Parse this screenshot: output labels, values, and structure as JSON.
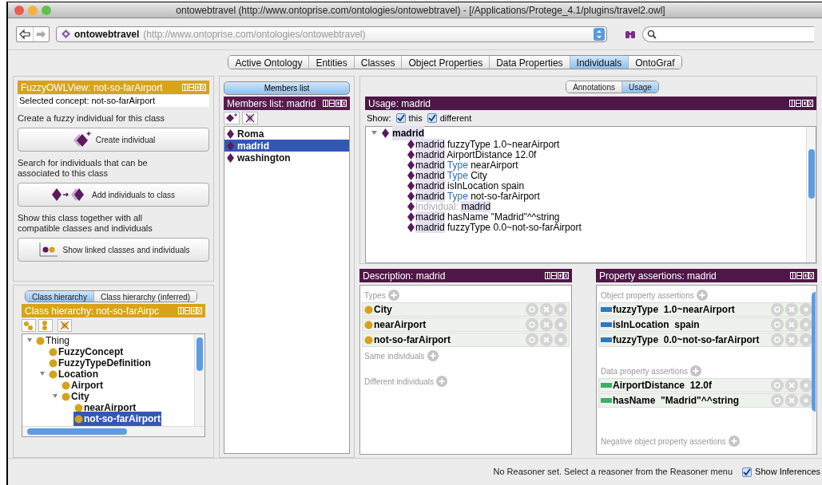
{
  "window": {
    "title": "ontowebtravel (http://www.ontoprise.com/ontologies/ontowebtravel) - [/Applications/Protege_4.1/plugins/travel2.owl]"
  },
  "address_bar": {
    "name": "ontowebtravel",
    "iri": "(http://www.ontoprise.com/ontologies/ontowebtravel)"
  },
  "tabs": [
    {
      "label": "Active Ontology",
      "selected": false
    },
    {
      "label": "Entities",
      "selected": false
    },
    {
      "label": "Classes",
      "selected": false
    },
    {
      "label": "Object Properties",
      "selected": false
    },
    {
      "label": "Data Properties",
      "selected": false
    },
    {
      "label": "Individuals",
      "selected": true
    },
    {
      "label": "OntoGraf",
      "selected": false
    }
  ],
  "fuzzy_owl_view": {
    "title": "FuzzyOWLView: not-so-farAirport",
    "selected_concept": "Selected concept: not-so-farAirport",
    "sections": [
      {
        "kind": "create",
        "text": "Create a fuzzy individual for this class",
        "button": "Create individual"
      },
      {
        "kind": "add",
        "text": "Search for individuals that can be associated to this class",
        "button": "Add individuals to class"
      },
      {
        "kind": "linked",
        "text": "Show this class together with all compatible classes and individuals",
        "button": "Show linked classes and individuals"
      }
    ]
  },
  "class_hierarchy": {
    "tabs": [
      {
        "label": "Class hierarchy",
        "selected": true
      },
      {
        "label": "Class hierarchy (inferred)",
        "selected": false
      }
    ],
    "title": "Class hierarchy: not-so-farAirpc",
    "tree": [
      {
        "label": "Thing",
        "expanded": true,
        "selected": false,
        "children": [
          {
            "label": "FuzzyConcept",
            "selected": false
          },
          {
            "label": "FuzzyTypeDefinition",
            "selected": false
          },
          {
            "label": "Location",
            "expanded": true,
            "selected": false,
            "children": [
              {
                "label": "Airport",
                "selected": false
              },
              {
                "label": "City",
                "expanded": true,
                "selected": false,
                "children": [
                  {
                    "label": "nearAirport",
                    "selected": false
                  },
                  {
                    "label": "not-so-farAirport",
                    "selected": true
                  }
                ]
              }
            ]
          }
        ]
      }
    ]
  },
  "members": {
    "button": "Members list",
    "title": "Members list: madrid",
    "items": [
      {
        "label": "Roma",
        "selected": false
      },
      {
        "label": "madrid",
        "selected": true
      },
      {
        "label": "washington",
        "selected": false
      }
    ]
  },
  "usage": {
    "tabs": [
      {
        "label": "Annotations",
        "selected": false
      },
      {
        "label": "Usage",
        "selected": true
      }
    ],
    "title": "Usage: madrid",
    "show_label": "Show:",
    "checkboxes": [
      {
        "label": "this",
        "checked": true
      },
      {
        "label": "different",
        "checked": true
      }
    ],
    "root": {
      "label": "madrid",
      "expanded": true
    },
    "lines": [
      {
        "kind": "plain",
        "subject": "madrid",
        "text": "fuzzyType 1.0~nearAirport"
      },
      {
        "kind": "plain",
        "subject": "madrid",
        "text": "AirportDistance 12.0f"
      },
      {
        "kind": "keyword",
        "subject": "madrid",
        "keyword": "Type",
        "text": "nearAirport"
      },
      {
        "kind": "keyword",
        "subject": "madrid",
        "keyword": "Type",
        "text": "City"
      },
      {
        "kind": "plain",
        "subject": "madrid",
        "text": "isInLocation spain"
      },
      {
        "kind": "keyword",
        "subject": "madrid",
        "keyword": "Type",
        "text": "not-so-farAirport"
      },
      {
        "kind": "declaration",
        "keyword": "Individual:",
        "subject": "madrid"
      },
      {
        "kind": "plain",
        "subject": "madrid",
        "text": "hasName \"Madrid\"^^string"
      },
      {
        "kind": "plain",
        "subject": "madrid",
        "text": "fuzzyType 0.0~not-so-farAirport"
      }
    ]
  },
  "description": {
    "title": "Description: madrid",
    "sections": [
      {
        "label": "Types",
        "items": [
          "City",
          "nearAirport",
          "not-so-farAirport"
        ]
      },
      {
        "label": "Same individuals"
      },
      {
        "label": "Different individuals"
      }
    ]
  },
  "property_assertions": {
    "title": "Property assertions: madrid",
    "sections": [
      {
        "kind": "object",
        "label": "Object property assertions",
        "items": [
          {
            "property": "fuzzyType",
            "value": "1.0~nearAirport"
          },
          {
            "property": "isInLocation",
            "value": "spain"
          },
          {
            "property": "fuzzyType",
            "value": "0.0~not-so-farAirport"
          }
        ]
      },
      {
        "kind": "data",
        "label": "Data property assertions",
        "items": [
          {
            "property": "AirportDistance",
            "value": "12.0f"
          },
          {
            "property": "hasName",
            "value": "\"Madrid\"^^string"
          }
        ]
      },
      {
        "kind": "negative",
        "label": "Negative object property assertions"
      }
    ]
  },
  "status_bar": {
    "message": "No Reasoner set. Select a reasoner from the Reasoner menu",
    "show_inferences": {
      "label": "Show Inferences",
      "checked": true
    }
  }
}
